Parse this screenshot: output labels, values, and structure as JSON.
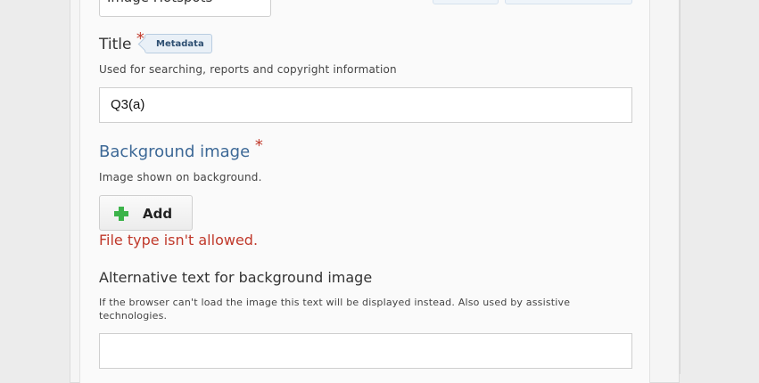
{
  "library_select": {
    "value": "Image Hotspots"
  },
  "title_field": {
    "label": "Title",
    "required_marker": "*",
    "badge": "Metadata",
    "description": "Used for searching, reports and copyright information",
    "value": "Q3(a)"
  },
  "background_image": {
    "label": "Background image",
    "required_marker": "*",
    "description": "Image shown on background.",
    "add_button_label": "Add",
    "error": "File type isn't allowed."
  },
  "alt_text_field": {
    "label": "Alternative text for background image",
    "description_line1": "If the browser can't load the image this text will be displayed instead. Also used by assistive",
    "description_line2": "technologies.",
    "value": ""
  },
  "icons": {
    "add": "plus-icon",
    "dropdown": "chevron-down-icon"
  },
  "colors": {
    "required": "#c0392b",
    "error": "#c0392b",
    "section_label": "#3c6896",
    "add_icon": "#3cb34a"
  }
}
